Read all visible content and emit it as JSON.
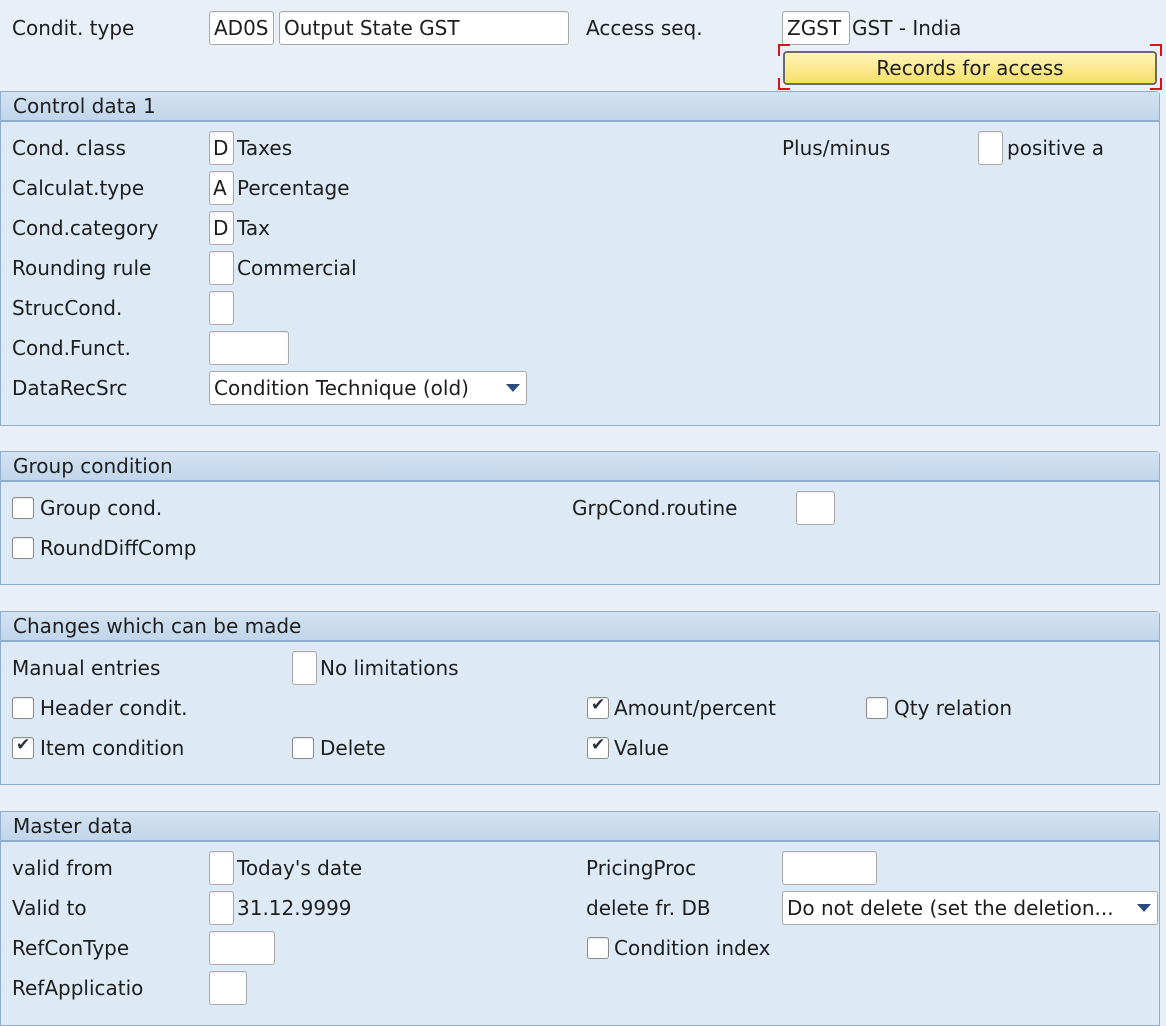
{
  "header": {
    "condit_type_label": "Condit. type",
    "condit_type_code": "AD0S",
    "condit_type_desc": "Output State GST",
    "access_seq_label": "Access seq.",
    "access_seq_code": "ZGST",
    "access_seq_desc": "GST - India",
    "records_button": "Records for access"
  },
  "control_data": {
    "title": "Control data 1",
    "cond_class": {
      "label": "Cond. class",
      "value": "D",
      "desc": "Taxes"
    },
    "calc_type": {
      "label": "Calculat.type",
      "value": "A",
      "desc": "Percentage"
    },
    "cond_category": {
      "label": "Cond.category",
      "value": "D",
      "desc": "Tax"
    },
    "rounding_rule": {
      "label": "Rounding rule",
      "value": "",
      "desc": "Commercial"
    },
    "struc_cond": {
      "label": "StrucCond.",
      "value": ""
    },
    "cond_funct": {
      "label": "Cond.Funct.",
      "value": ""
    },
    "data_rec_src": {
      "label": "DataRecSrc",
      "selected": "Condition Technique (old)"
    },
    "plus_minus": {
      "label": "Plus/minus",
      "value": "",
      "desc": "positive a"
    }
  },
  "group_condition": {
    "title": "Group condition",
    "group_cond": {
      "label": "Group cond.",
      "checked": false
    },
    "round_diff_comp": {
      "label": "RoundDiffComp",
      "checked": false
    },
    "grp_cond_routine": {
      "label": "GrpCond.routine",
      "value": ""
    }
  },
  "changes": {
    "title": "Changes which can be made",
    "manual_entries": {
      "label": "Manual entries",
      "value": "",
      "desc": "No limitations"
    },
    "header_condit": {
      "label": "Header condit.",
      "checked": false
    },
    "item_condition": {
      "label": "Item condition",
      "checked": true
    },
    "delete": {
      "label": "Delete",
      "checked": false
    },
    "amount_percent": {
      "label": "Amount/percent",
      "checked": true
    },
    "value": {
      "label": "Value",
      "checked": true
    },
    "qty_relation": {
      "label": "Qty relation",
      "checked": false
    }
  },
  "master_data": {
    "title": "Master data",
    "valid_from": {
      "label": "valid from",
      "value": "",
      "desc": "Today's date"
    },
    "valid_to": {
      "label": "Valid to",
      "value": "",
      "desc": "31.12.9999"
    },
    "ref_con_type": {
      "label": "RefConType",
      "value": ""
    },
    "ref_applicatio": {
      "label": "RefApplicatio",
      "value": ""
    },
    "pricing_proc": {
      "label": "PricingProc",
      "value": ""
    },
    "delete_fr_db": {
      "label": "delete fr. DB",
      "selected": "Do not delete (set the deletion..."
    },
    "condition_index": {
      "label": "Condition index",
      "checked": false
    }
  }
}
